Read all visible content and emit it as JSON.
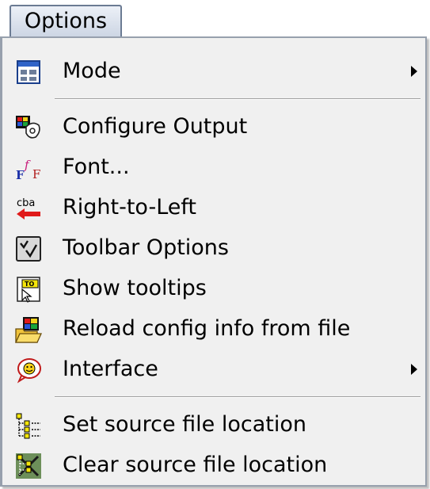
{
  "menubar": {
    "options_label": "Options"
  },
  "menu": {
    "items": [
      {
        "label": "Mode",
        "icon": "window-layout-icon",
        "submenu": true
      },
      {
        "label": "Configure Output",
        "icon": "configure-output-icon",
        "submenu": false
      },
      {
        "label": "Font...",
        "icon": "font-icon",
        "submenu": false
      },
      {
        "label": "Right-to-Left",
        "icon": "right-to-left-icon",
        "submenu": false
      },
      {
        "label": "Toolbar Options",
        "icon": "toolbar-options-icon",
        "submenu": false
      },
      {
        "label": "Show tooltips",
        "icon": "tooltip-icon",
        "submenu": false
      },
      {
        "label": "Reload config info from file",
        "icon": "reload-config-icon",
        "submenu": false
      },
      {
        "label": "Interface",
        "icon": "interface-icon",
        "submenu": true
      },
      {
        "label": "Set source file location",
        "icon": "set-source-location-icon",
        "submenu": false
      },
      {
        "label": "Clear source file location",
        "icon": "clear-source-location-icon",
        "submenu": false
      }
    ],
    "icon_text": {
      "right_to_left_letters": "cba",
      "tooltip_letters": "TO"
    }
  }
}
